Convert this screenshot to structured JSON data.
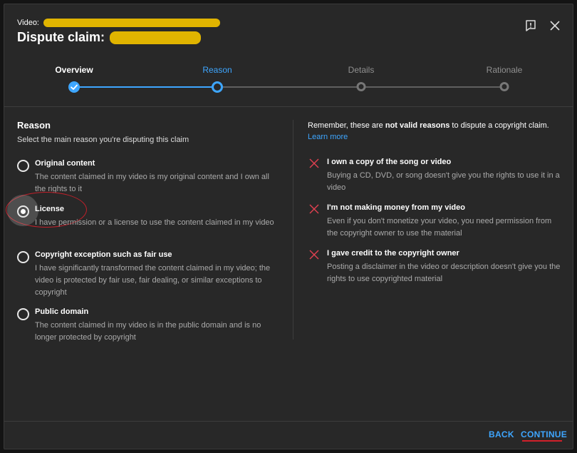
{
  "dialog": {
    "video_label": "Video:",
    "title": "Dispute claim:"
  },
  "stepper": {
    "steps": [
      {
        "label": "Overview",
        "state": "done"
      },
      {
        "label": "Reason",
        "state": "active"
      },
      {
        "label": "Details",
        "state": "todo"
      },
      {
        "label": "Rationale",
        "state": "todo"
      }
    ]
  },
  "reason": {
    "title": "Reason",
    "subtitle": "Select the main reason you're disputing this claim",
    "selected_index": 1,
    "options": [
      {
        "label": "Original content",
        "desc": "The content claimed in my video is my original content and I own all the rights to it"
      },
      {
        "label": "License",
        "desc": "I have permission or a license to use the content claimed in my video"
      },
      {
        "label": "Copyright exception such as fair use",
        "desc": "I have significantly transformed the content claimed in my video; the video is protected by fair use, fair dealing, or similar exceptions to copyright"
      },
      {
        "label": "Public domain",
        "desc": "The content claimed in my video is in the public domain and is no longer protected by copyright"
      }
    ]
  },
  "invalid_reasons": {
    "intro_before": "Remember, these are ",
    "intro_bold": "not valid reasons",
    "intro_after": " to dispute a copyright claim.",
    "learn_more": "Learn more",
    "items": [
      {
        "title": "I own a copy of the song or video",
        "desc": "Buying a CD, DVD, or song doesn't give you the rights to use it in a video"
      },
      {
        "title": "I'm not making money from my video",
        "desc": "Even if you don't monetize your video, you need permission from the copyright owner to use the material"
      },
      {
        "title": "I gave credit to the copyright owner",
        "desc": "Posting a disclaimer in the video or description doesn't give you the rights to use copyrighted material"
      }
    ]
  },
  "footer": {
    "back_label": "BACK",
    "continue_label": "CONTINUE"
  },
  "colors": {
    "accent": "#3ea6ff",
    "redaction": "#e0b400",
    "annotation_red": "#c0202a",
    "invalid_x": "#e04050"
  },
  "icons": {
    "feedback": "feedback-icon",
    "close": "close-icon",
    "check": "check-icon",
    "invalid": "x-mark-icon"
  }
}
